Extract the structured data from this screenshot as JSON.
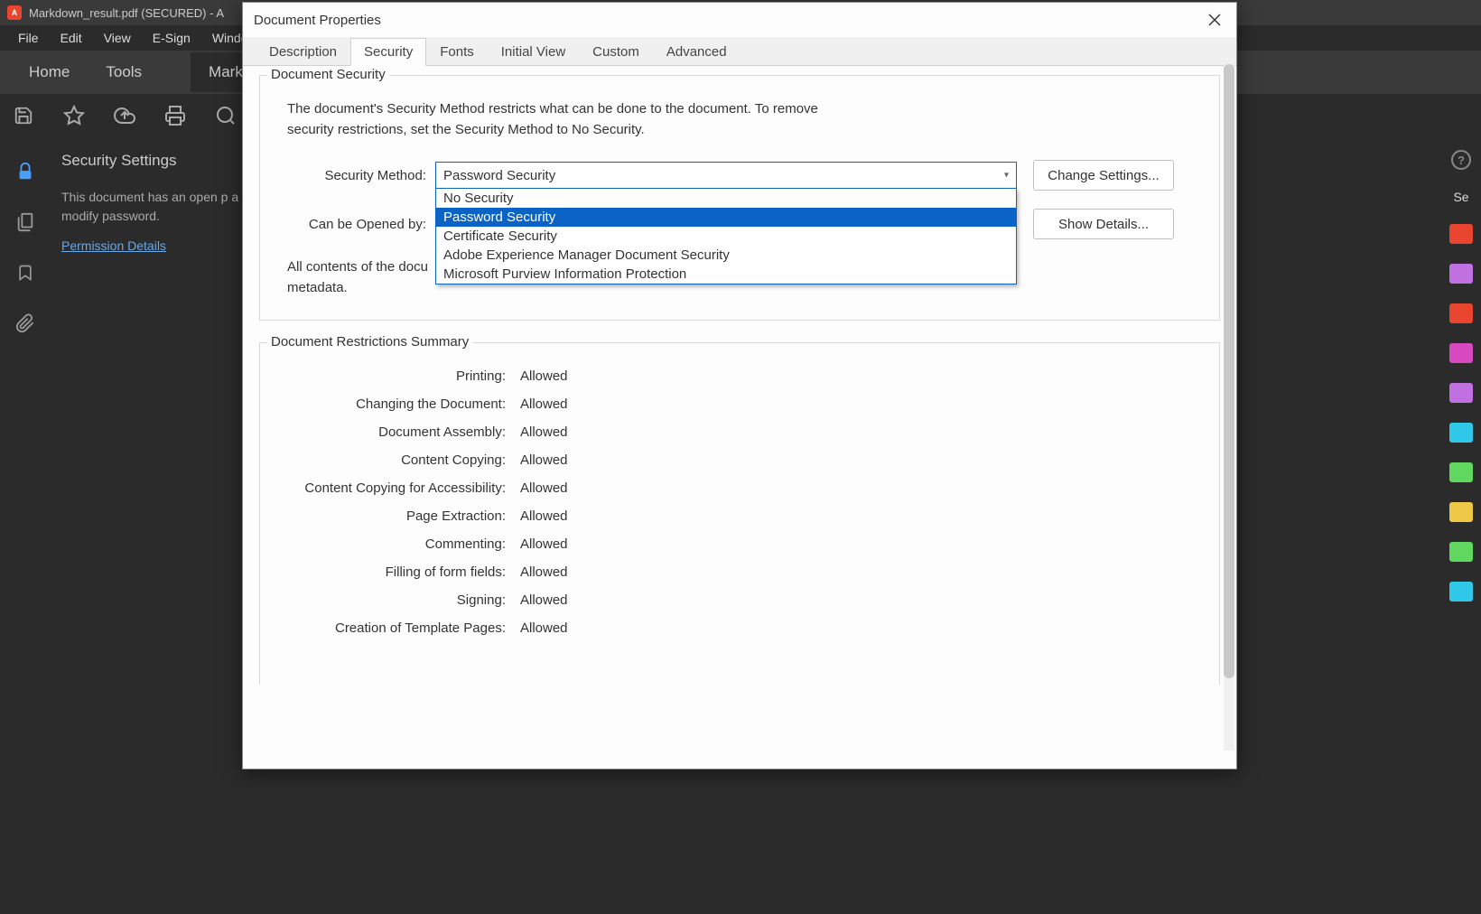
{
  "titleBar": {
    "appTitle": "Markdown_result.pdf (SECURED) - A"
  },
  "menuBar": {
    "items": [
      "File",
      "Edit",
      "View",
      "E-Sign",
      "Window"
    ]
  },
  "mainTabs": {
    "home": "Home",
    "tools": "Tools",
    "doc": "Markd"
  },
  "leftPanel": {
    "title": "Security Settings",
    "body": "This document has an open p a modify password.",
    "link": "Permission Details"
  },
  "rightEdge": {
    "text": "Se"
  },
  "dialog": {
    "title": "Document Properties",
    "tabs": [
      "Description",
      "Security",
      "Fonts",
      "Initial View",
      "Custom",
      "Advanced"
    ],
    "activeTab": 1,
    "security": {
      "groupTitle": "Document Security",
      "helpText": "The document's Security Method restricts what can be done to the document. To remove security restrictions, set the Security Method to No Security.",
      "methodLabel": "Security Method:",
      "methodValue": "Password Security",
      "options": [
        "No Security",
        "Password Security",
        "Certificate Security",
        "Adobe Experience Manager Document Security",
        "Microsoft Purview Information Protection"
      ],
      "selectedOption": 1,
      "openedByLabel": "Can be Opened by:",
      "contentsText": "All contents of the docu metadata.",
      "changeSettings": "Change Settings...",
      "showDetails": "Show Details..."
    },
    "restrictions": {
      "groupTitle": "Document Restrictions Summary",
      "rows": [
        {
          "label": "Printing:",
          "value": "Allowed"
        },
        {
          "label": "Changing the Document:",
          "value": "Allowed"
        },
        {
          "label": "Document Assembly:",
          "value": "Allowed"
        },
        {
          "label": "Content Copying:",
          "value": "Allowed"
        },
        {
          "label": "Content Copying for Accessibility:",
          "value": "Allowed"
        },
        {
          "label": "Page Extraction:",
          "value": "Allowed"
        },
        {
          "label": "Commenting:",
          "value": "Allowed"
        },
        {
          "label": "Filling of form fields:",
          "value": "Allowed"
        },
        {
          "label": "Signing:",
          "value": "Allowed"
        },
        {
          "label": "Creation of Template Pages:",
          "value": "Allowed"
        }
      ]
    }
  }
}
